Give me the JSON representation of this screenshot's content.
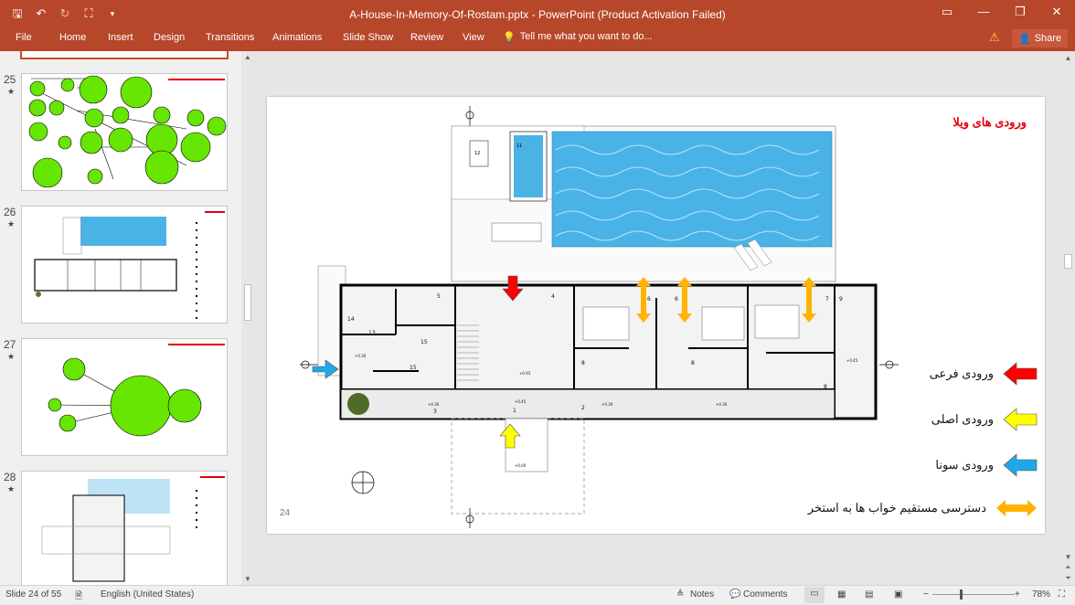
{
  "window": {
    "title": "A-House-In-Memory-Of-Rostam.pptx - PowerPoint (Product Activation Failed)",
    "controls": [
      "▭",
      "—",
      "❐",
      "✕"
    ]
  },
  "ribbon": {
    "tabs": [
      "File",
      "Home",
      "Insert",
      "Design",
      "Transitions",
      "Animations",
      "Slide Show",
      "Review",
      "View"
    ],
    "tell_me": "Tell me what you want to do...",
    "share": "Share"
  },
  "thumbnails": [
    {
      "number": "25",
      "star": "★"
    },
    {
      "number": "26",
      "star": "★"
    },
    {
      "number": "27",
      "star": "★"
    },
    {
      "number": "28",
      "star": "★"
    }
  ],
  "slide": {
    "title": "ورودی های ویلا",
    "page_number": "24",
    "legend": [
      {
        "label": "ورودی فرعی",
        "color": "#ff0000",
        "icon": "arrow-left"
      },
      {
        "label": "ورودی اصلی",
        "color": "#ffff00",
        "icon": "arrow-left"
      },
      {
        "label": "ورودی سونا",
        "color": "#1fa8e8",
        "icon": "arrow-left"
      },
      {
        "label": "دسترسی مستقیم خواب ها به استخر",
        "color": "#ffb300",
        "icon": "arrow-double"
      }
    ],
    "plan_labels": [
      "12",
      "11",
      "4",
      "5",
      "6",
      "6",
      "7",
      "9",
      "14",
      "13",
      "15",
      "15",
      "8",
      "8",
      "8",
      "3",
      "2",
      "1"
    ],
    "levels": [
      "+0.45",
      "+0.30",
      "+0.30",
      "+0.30",
      "+0.45",
      "+0.00",
      "+0.30",
      "+0.45"
    ],
    "colors": {
      "entry_side": "#ff0000",
      "entry_main": "#ffff00",
      "entry_sauna": "#1fa8e8",
      "pool_access": "#ffb300",
      "pool": "#4ab3e6"
    }
  },
  "status": {
    "slide_info": "Slide 24 of 55",
    "language": "English (United States)",
    "notes": "Notes",
    "comments": "Comments",
    "zoom": "78%"
  },
  "thumb_colors": {
    "bubble": "#66e600"
  }
}
